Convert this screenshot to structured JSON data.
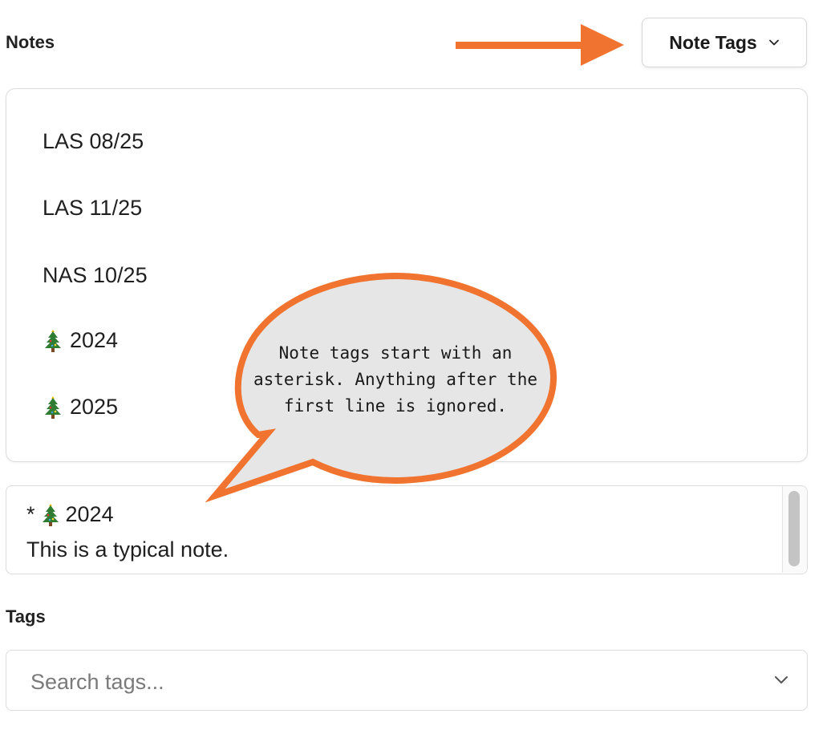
{
  "notes_label": "Notes",
  "note_tags_button": {
    "label": "Note Tags",
    "icon": "chevron-down-icon"
  },
  "tag_list": [
    {
      "label": "LAS 08/25",
      "icon": ""
    },
    {
      "label": "LAS 11/25",
      "icon": ""
    },
    {
      "label": "NAS 10/25",
      "icon": ""
    },
    {
      "label": "2024",
      "icon": "christmas-tree-icon"
    },
    {
      "label": "2025",
      "icon": "christmas-tree-icon"
    }
  ],
  "note": {
    "prefix": "*",
    "tag_icon": "christmas-tree-icon",
    "tag_label": "2024",
    "body": "This is a typical note."
  },
  "tags_label": "Tags",
  "tags_search": {
    "placeholder": "Search tags...",
    "value": ""
  },
  "callout": {
    "lines": [
      "Note tags start with an",
      "asterisk.  Anything after the",
      "first line is ignored."
    ]
  },
  "colors": {
    "accent_orange": "#f07430",
    "bubble_fill": "#e6e6e6",
    "border": "#dcdcdc",
    "tree_green": "#2f7d32"
  }
}
